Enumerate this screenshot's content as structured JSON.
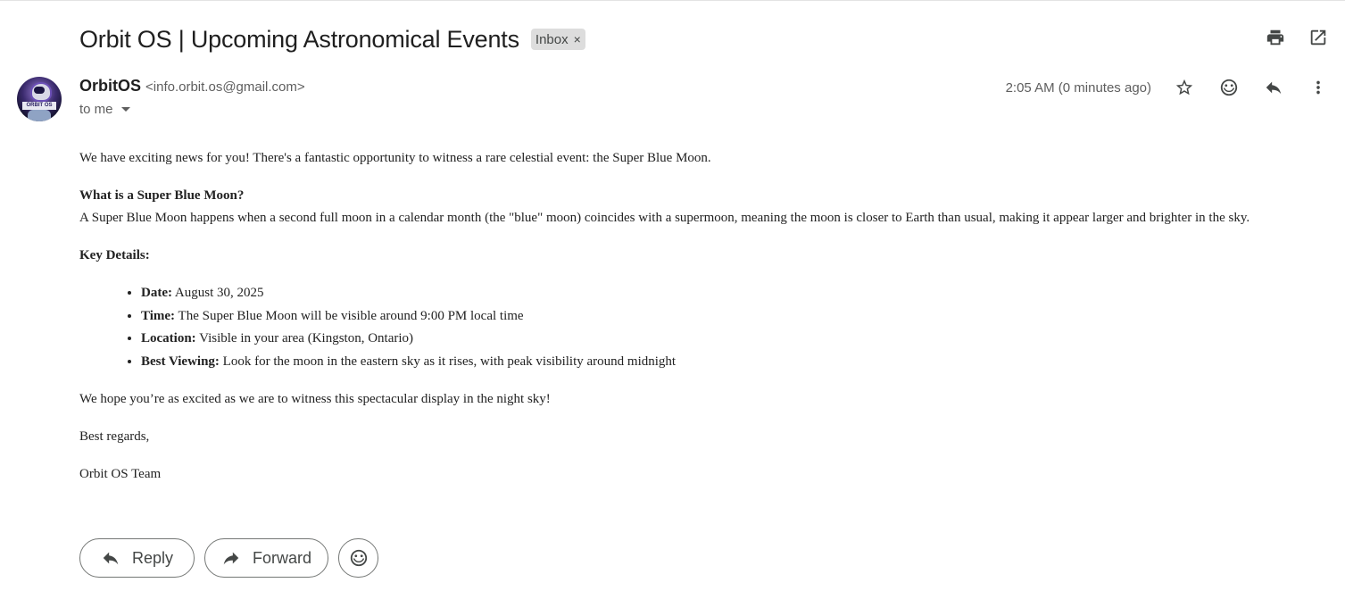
{
  "email": {
    "subject": "Orbit OS | Upcoming Astronomical Events",
    "label": "Inbox",
    "label_remove": "×",
    "sender_name": "OrbitOS",
    "sender_email": "<info.orbit.os@gmail.com>",
    "recipient": "to me",
    "timestamp": "2:05 AM (0 minutes ago)",
    "avatar_text": "ORBIT OS"
  },
  "body": {
    "intro": "We have exciting news for you! There's a fantastic opportunity to witness a rare celestial event: the Super Blue Moon.",
    "heading1": "What is a Super Blue Moon?",
    "para1": "A Super Blue Moon happens when a second full moon in a calendar month (the \"blue\" moon) coincides with a supermoon, meaning the moon is closer to Earth than usual, making it appear larger and brighter in the sky.",
    "heading2": "Key Details:",
    "details": [
      {
        "label": "Date:",
        "value": " August 30, 2025"
      },
      {
        "label": "Time:",
        "value": " The Super Blue Moon will be visible around 9:00 PM local time"
      },
      {
        "label": "Location:",
        "value": " Visible in your area (Kingston, Ontario)"
      },
      {
        "label": "Best Viewing:",
        "value": " Look for the moon in the eastern sky as it rises, with peak visibility around midnight"
      }
    ],
    "closing": "We hope you’re as excited as we are to witness this spectacular display in the night sky!",
    "signoff": "Best regards,",
    "signature": "Orbit OS Team"
  },
  "actions": {
    "reply_label": "Reply",
    "forward_label": "Forward"
  },
  "icons": {
    "print": "print-icon",
    "open_new": "open-in-new-window-icon",
    "star": "star-icon",
    "emoji": "emoji-icon",
    "reply": "reply-icon",
    "more": "more-vert-icon",
    "forward": "forward-icon"
  }
}
